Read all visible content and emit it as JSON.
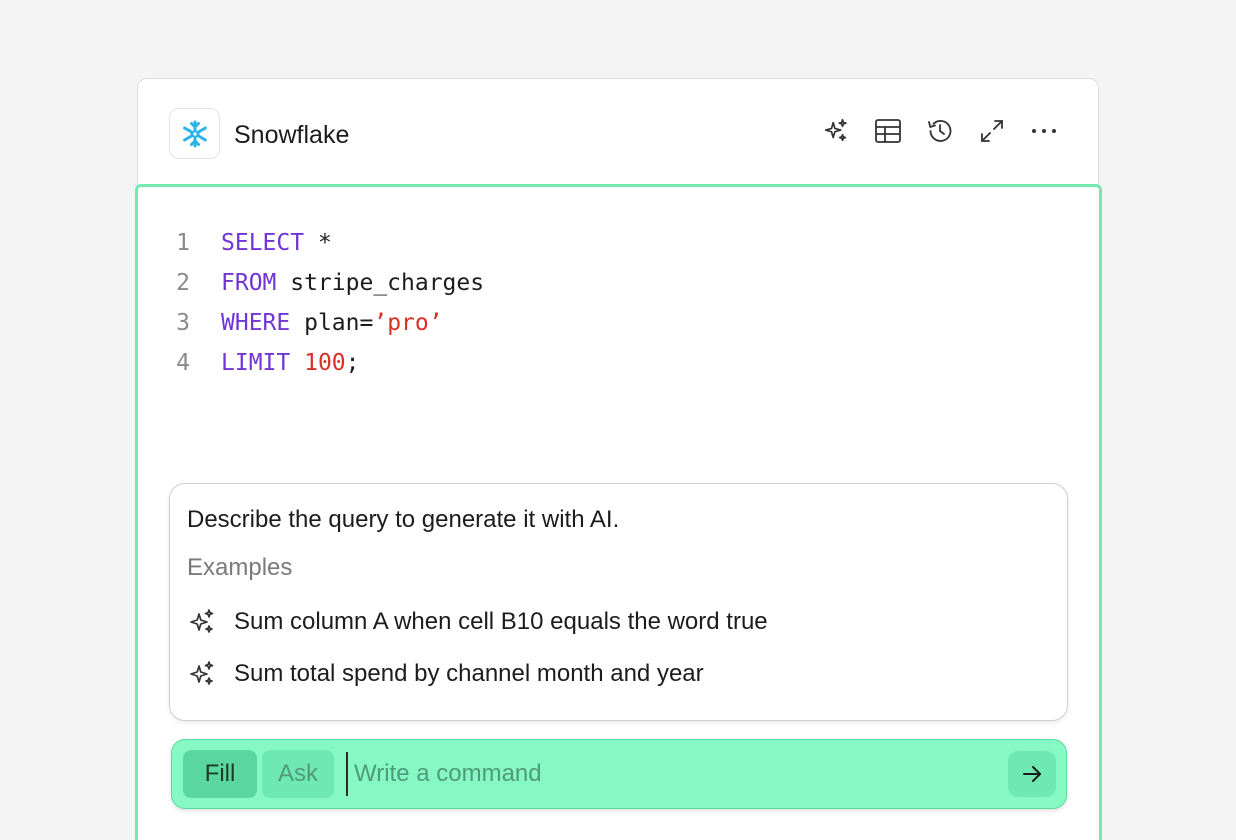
{
  "header": {
    "title": "Snowflake",
    "logo_icon": "snowflake-icon",
    "logo_color": "#29b5e8",
    "tools": [
      {
        "name": "ai-sparkle-button",
        "icon": "sparkles-icon"
      },
      {
        "name": "table-view-button",
        "icon": "table-icon"
      },
      {
        "name": "history-button",
        "icon": "history-icon"
      },
      {
        "name": "expand-button",
        "icon": "expand-icon"
      },
      {
        "name": "more-button",
        "icon": "more-horizontal-icon"
      }
    ]
  },
  "editor": {
    "border_color": "#74e9b0",
    "lines": [
      {
        "num": "1",
        "kw": "SELECT",
        "rest": " *"
      },
      {
        "num": "2",
        "kw": "FROM",
        "rest": " stripe_charges"
      },
      {
        "num": "3",
        "kw": "WHERE",
        "rest": " plan=",
        "str": "’pro’"
      },
      {
        "num": "4",
        "kw": "LIMIT",
        "rest": " ",
        "num_val": "100",
        "tail": ";"
      }
    ]
  },
  "suggestions": {
    "title": "Describe the query to generate it with AI.",
    "examples_label": "Examples",
    "examples": [
      {
        "label": "Sum column A when cell B10 equals the word true",
        "icon": "sparkles-icon"
      },
      {
        "label": "Sum total spend by channel month and year",
        "icon": "sparkles-icon"
      }
    ]
  },
  "command_bar": {
    "fill_label": "Fill",
    "ask_label": "Ask",
    "placeholder": "Write a command",
    "value": "",
    "send_icon": "arrow-right-icon",
    "bg_color": "#86f8c4"
  }
}
